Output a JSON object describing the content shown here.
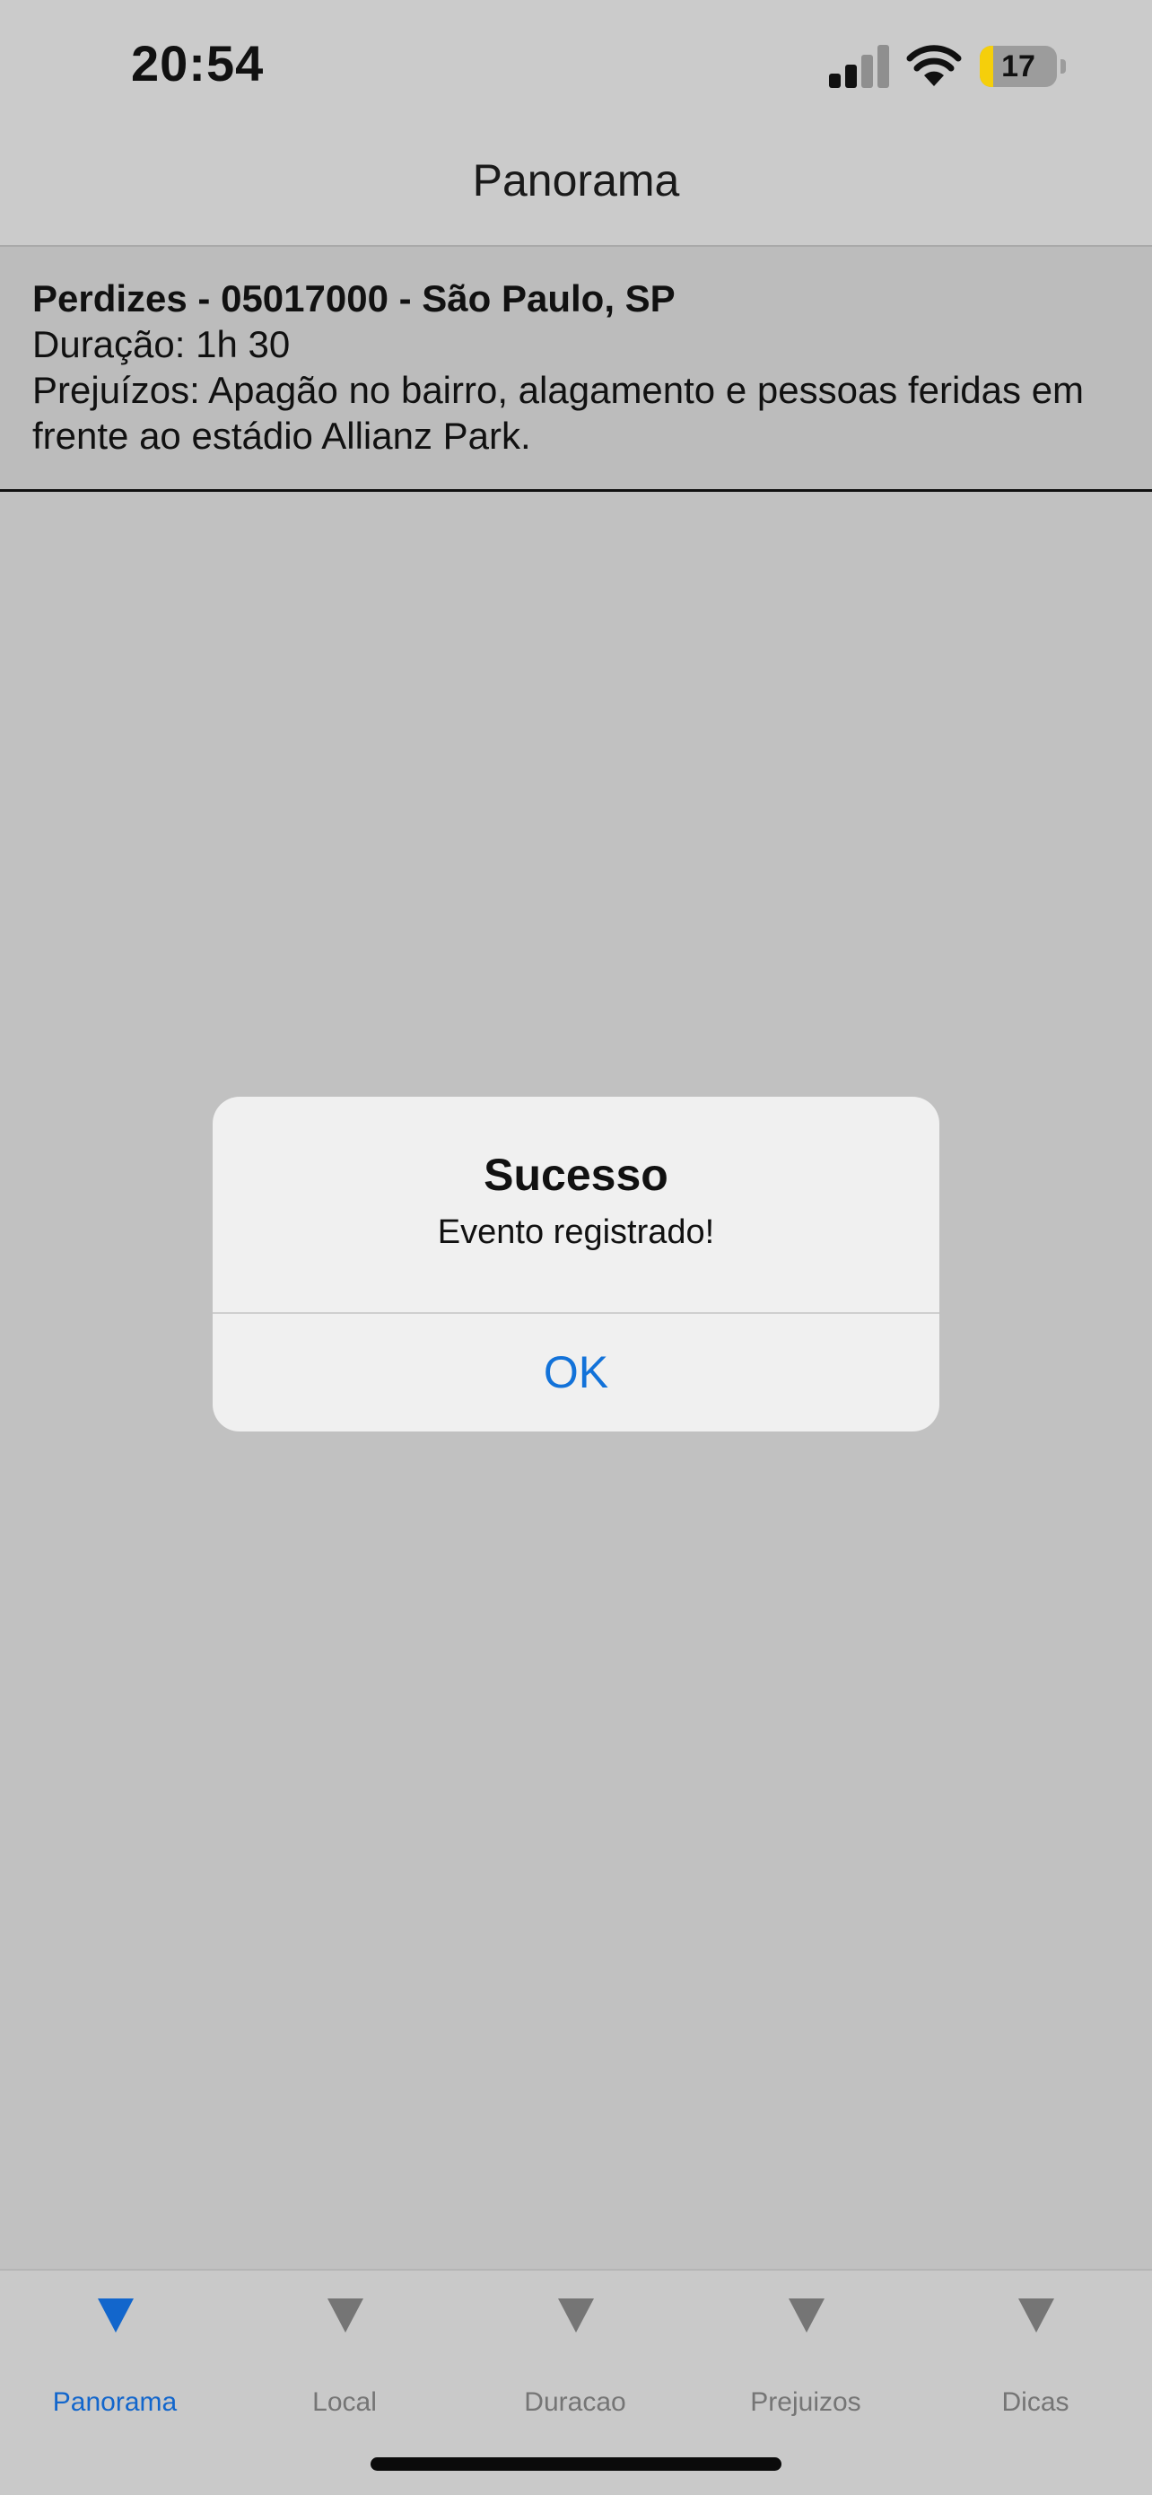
{
  "status_bar": {
    "time": "20:54",
    "battery_level": "17",
    "battery_fraction": 0.17,
    "icons": [
      "signal-icon",
      "wifi-icon",
      "battery-icon"
    ]
  },
  "nav": {
    "title": "Panorama"
  },
  "event": {
    "title": "Perdizes - 05017000 - São Paulo, SP",
    "duration": "Duração: 1h 30",
    "damages_line1": "Prejuízos: Apagão no bairro, alagamento e pessoas feridas em",
    "damages_line2": "frente ao estádio Allianz Park."
  },
  "alert": {
    "title": "Sucesso",
    "message": "Evento registrado!",
    "button": "OK"
  },
  "tabs": [
    {
      "label": "Panorama",
      "icon": "triangle-down-icon",
      "active": true
    },
    {
      "label": "Local",
      "icon": "triangle-down-icon",
      "active": false
    },
    {
      "label": "Duracao",
      "icon": "triangle-down-icon",
      "active": false
    },
    {
      "label": "Prejuizos",
      "icon": "triangle-down-icon",
      "active": false
    },
    {
      "label": "Dicas",
      "icon": "triangle-down-icon",
      "active": false
    }
  ],
  "colors": {
    "accent": "#1266cc",
    "alert_button": "#1272d9",
    "inactive_tab": "#757575",
    "battery_low": "#f5cf0b"
  }
}
